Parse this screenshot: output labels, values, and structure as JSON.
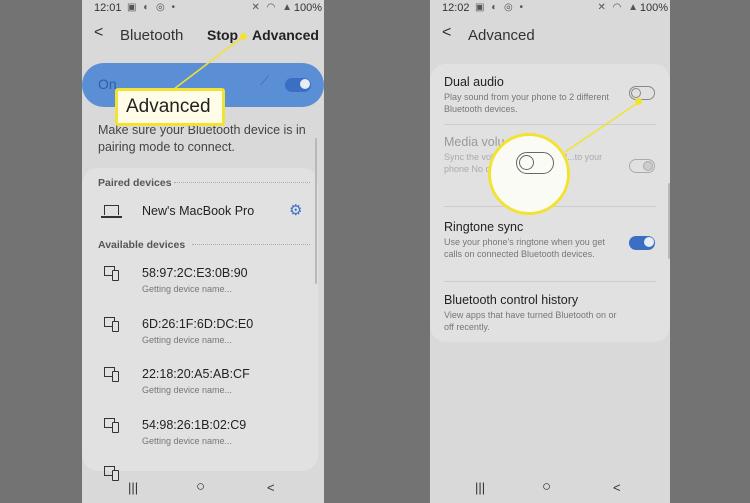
{
  "left_screen": {
    "status": {
      "time": "12:01",
      "left_icons": "▣ ◐ ◎ •",
      "right_icons": "✕ ◠ ▲",
      "battery": "100%"
    },
    "header": {
      "back_label": "<",
      "title": "Bluetooth",
      "stop_label": "Stop",
      "advanced_label": "Advanced"
    },
    "bluetooth_toggle": {
      "label": "On",
      "state": true
    },
    "pairing_hint": "Make sure your Bluetooth device is in pairing mode to connect.",
    "paired_section": {
      "label": "Paired devices",
      "devices": [
        {
          "name": "New's MacBook Pro",
          "icon": "laptop-icon"
        }
      ]
    },
    "available_section": {
      "label": "Available devices",
      "devices": [
        {
          "name": "58:97:2C:E3:0B:90",
          "status": "Getting device name..."
        },
        {
          "name": "6D:26:1F:6D:DC:E0",
          "status": "Getting device name..."
        },
        {
          "name": "22:18:20:A5:AB:CF",
          "status": "Getting device name..."
        },
        {
          "name": "54:98:26:1B:02:C9",
          "status": "Getting device name..."
        }
      ]
    },
    "nav": {
      "recents": "|||",
      "home": "○",
      "back": "<"
    }
  },
  "callout": {
    "label": "Advanced",
    "color": "#f2e233"
  },
  "right_screen": {
    "status": {
      "time": "12:02",
      "left_icons": "▣ ◐ ◎ •",
      "right_icons": "✕ ◠ ▲",
      "battery": "100%"
    },
    "header": {
      "back_label": "<",
      "title": "Advanced"
    },
    "settings": [
      {
        "title": "Dual audio",
        "description": "Play sound from your phone to 2 different Bluetooth devices.",
        "toggle": false
      },
      {
        "title": "Media volu",
        "description": "Sync the volu...le connected Bl...to your phone No connected...",
        "toggle": true,
        "disabled": true
      },
      {
        "title": "Ringtone sync",
        "description": "Use your phone's ringtone when you get calls on connected Bluetooth devices.",
        "toggle": true
      },
      {
        "title": "Bluetooth control history",
        "description": "View apps that have turned Bluetooth on or off recently."
      }
    ],
    "nav": {
      "recents": "|||",
      "home": "○",
      "back": "<"
    }
  },
  "colors": {
    "accent": "#3a6fc4",
    "highlight": "#f2e233",
    "background": "#737373"
  }
}
